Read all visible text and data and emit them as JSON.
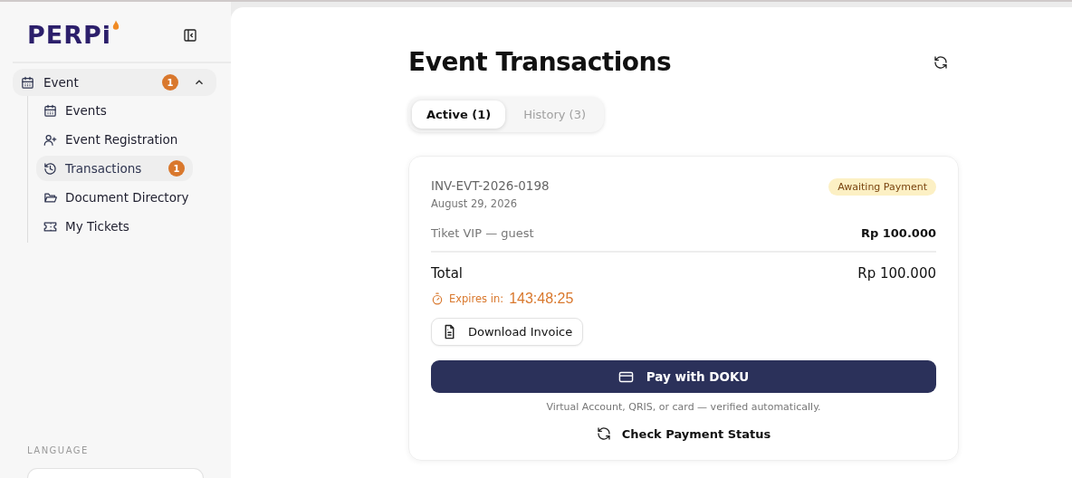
{
  "sidebar": {
    "logo": "PERPi",
    "nav": [
      {
        "label": "Event",
        "badge": "1",
        "expanded": true,
        "selected": false,
        "children": [
          {
            "label": "Events",
            "selected": false
          },
          {
            "label": "Event Registration",
            "selected": false
          },
          {
            "label": "Transactions",
            "badge": "1",
            "selected": true
          },
          {
            "label": "Document Directory",
            "selected": false
          },
          {
            "label": "My Tickets",
            "selected": false
          }
        ]
      }
    ],
    "language_label": "LANGUAGE"
  },
  "page": {
    "title": "Event Transactions",
    "tabs": [
      {
        "label": "Active (1)",
        "selected": true
      },
      {
        "label": "History (3)",
        "selected": false
      }
    ],
    "transaction": {
      "invoice": "INV-EVT-2026-0198",
      "date": "August 29, 2026",
      "status": "Awaiting Payment",
      "items": [
        {
          "name": "Tiket VIP — guest",
          "amount": "Rp 100.000"
        }
      ],
      "total_label": "Total",
      "total": "Rp 100.000",
      "expires_label": "Expires in:",
      "expires": "143:48:25",
      "download_button": "Download Invoice",
      "pay_button": "Pay with DOKU",
      "pay_note": "Virtual Account, QRIS, or card — verified automatically.",
      "check_button": "Check Payment Status"
    }
  }
}
